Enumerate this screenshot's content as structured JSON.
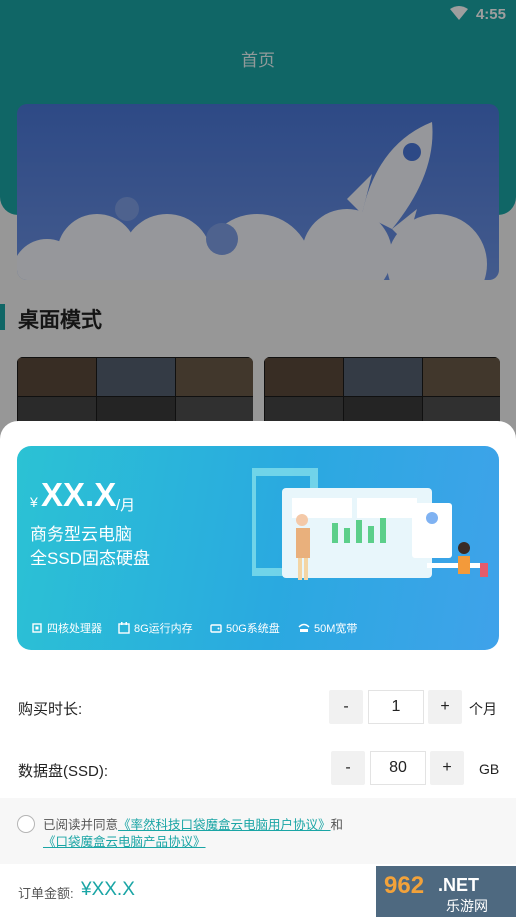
{
  "status_bar": {
    "time": "4:55",
    "wifi_icon": "wifi-icon"
  },
  "header": {
    "title": "首页"
  },
  "section": {
    "title": "桌面模式"
  },
  "promo": {
    "price_symbol": "¥",
    "price": "XX.X",
    "price_unit": "/月",
    "line1": "商务型云电脑",
    "line2": "全SSD固态硬盘",
    "features": [
      {
        "icon": "cpu-icon",
        "label": "四核处理器"
      },
      {
        "icon": "memory-icon",
        "label": "8G运行内存"
      },
      {
        "icon": "disk-icon",
        "label": "50G系统盘"
      },
      {
        "icon": "bandwidth-icon",
        "label": "50M宽带"
      }
    ]
  },
  "duration": {
    "label": "购买时长:",
    "minus": "-",
    "value": "1",
    "plus": "+",
    "unit": "个月"
  },
  "datadisk": {
    "label": "数据盘(SSD):",
    "minus": "-",
    "value": "80",
    "plus": "+",
    "unit": "GB"
  },
  "agreement": {
    "prefix": "已阅读并同意",
    "link1": "《率然科技口袋魔盒云电脑用户协议》",
    "and": "和",
    "link2": "《口袋魔盒云电脑产品协议》"
  },
  "order": {
    "label": "订单金额:",
    "price": "¥XX.X"
  },
  "watermark": {
    "main": "962.NET",
    "sub": "乐游网"
  },
  "colors": {
    "accent": "#1aa5a5",
    "promo_start": "#2bc2d4",
    "promo_end": "#3fa2ea"
  }
}
